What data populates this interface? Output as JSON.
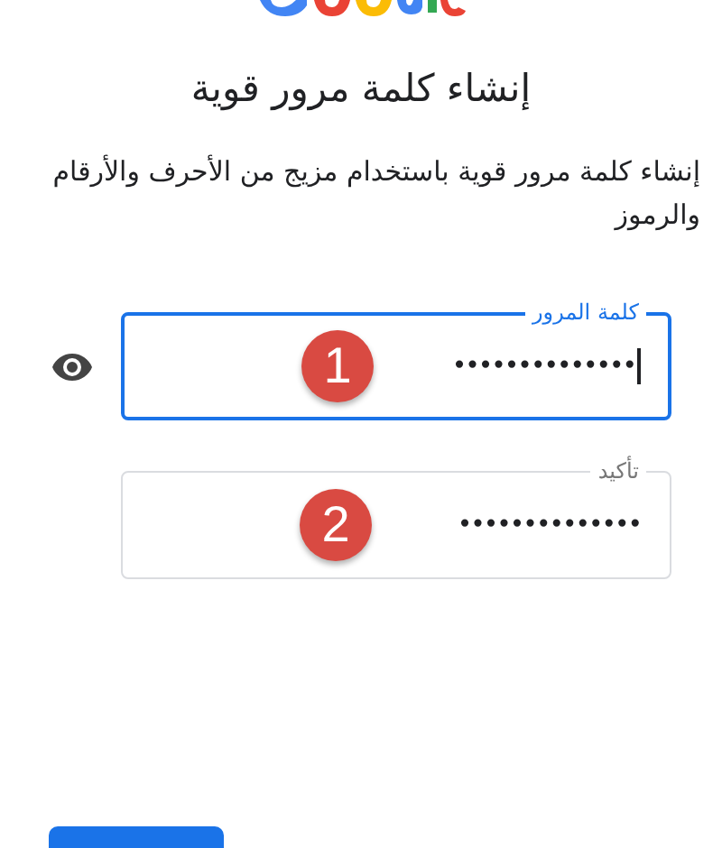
{
  "title": "إنشاء كلمة مرور قوية",
  "subtitle": "إنشاء كلمة مرور قوية باستخدام مزيج من الأحرف والأرقام والرموز",
  "fields": [
    {
      "label": "كلمة المرور",
      "value": "••••••••••••••",
      "focused": true,
      "show_password_icon": true,
      "marker": "1"
    },
    {
      "label": "تأكيد",
      "value": "••••••••••••••",
      "focused": false,
      "show_password_icon": false,
      "marker": "2"
    }
  ]
}
